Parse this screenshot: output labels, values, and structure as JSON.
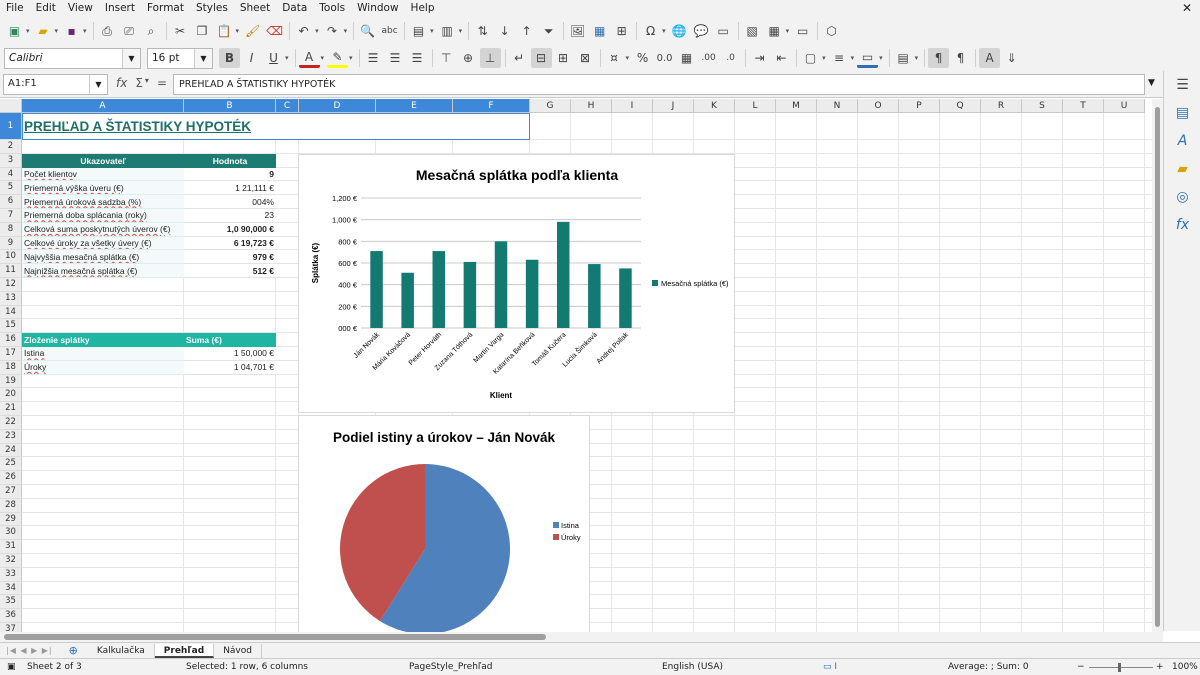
{
  "menu": [
    "File",
    "Edit",
    "View",
    "Insert",
    "Format",
    "Styles",
    "Sheet",
    "Data",
    "Tools",
    "Window",
    "Help"
  ],
  "toolbar": {
    "font_name": "Calibri",
    "font_size": "16 pt"
  },
  "formula": {
    "name_box": "A1:F1",
    "content": "PREHĽAD A ŠTATISTIKY HYPOTÉK"
  },
  "columns": [
    "A",
    "B",
    "C",
    "D",
    "E",
    "F",
    "G",
    "H",
    "I",
    "J",
    "K",
    "L",
    "M",
    "N",
    "O",
    "P",
    "Q",
    "R",
    "S",
    "T",
    "U"
  ],
  "rows": [
    "1",
    "2",
    "3",
    "4",
    "5",
    "6",
    "7",
    "8",
    "9",
    "10",
    "11",
    "12",
    "13",
    "14",
    "15",
    "16",
    "17",
    "18",
    "19",
    "20",
    "21",
    "22",
    "23",
    "24",
    "25",
    "26",
    "27",
    "28",
    "29",
    "30",
    "31",
    "32",
    "33",
    "34",
    "35",
    "36",
    "37"
  ],
  "sheet": {
    "title": "PREHĽAD A ŠTATISTIKY HYPOTÉK",
    "stats_header": {
      "label": "Ukazovateľ",
      "value": "Hodnota"
    },
    "stats": [
      {
        "label": "Počet klientov",
        "value": "9",
        "bold": true
      },
      {
        "label": "Priemerná výška úveru (€)",
        "value": "1 21,111 €",
        "bold": false
      },
      {
        "label": "Priemerná úroková sadzba (%)",
        "value": "004%",
        "bold": false
      },
      {
        "label": "Priemerná doba splácania (roky)",
        "value": "23",
        "bold": false
      },
      {
        "label": "Celková suma poskytnutých úverov (€)",
        "value": "1,0 90,000 €",
        "bold": true
      },
      {
        "label": "Celkové úroky za všetky úvery (€)",
        "value": "6 19,723 €",
        "bold": true
      },
      {
        "label": "Najvyššia mesačná splátka (€)",
        "value": "979 €",
        "bold": true
      },
      {
        "label": "Najnižšia mesačná splátka (€)",
        "value": "512 €",
        "bold": true
      }
    ],
    "comp_header": {
      "label": "Zloženie splátky",
      "value": "Suma (€)"
    },
    "comp": [
      {
        "label": "Istina",
        "value": "1 50,000 €"
      },
      {
        "label": "Úroky",
        "value": "1 04,701 €"
      }
    ]
  },
  "chart_data": [
    {
      "type": "bar",
      "title": "Mesačná splátka podľa klienta",
      "xlabel": "Klient",
      "ylabel": "Splátka (€)",
      "categories": [
        "Ján Novák",
        "Mária Kováčová",
        "Peter Horváth",
        "Zuzana Tóthová",
        "Martin Varga",
        "Katarína Beňková",
        "Tomáš Kučera",
        "Lucia Šimková",
        "Andrej Poliak"
      ],
      "series": [
        {
          "name": "Mesačná splátka (€)",
          "values": [
            710,
            510,
            710,
            610,
            800,
            630,
            980,
            590,
            550
          ]
        }
      ],
      "ylim": [
        0,
        1200
      ],
      "yticks": [
        "000 €",
        "200 €",
        "400 €",
        "600 €",
        "800 €",
        "1,000 €",
        "1,200 €"
      ],
      "color": "#137a72",
      "grid": true,
      "legend": "right"
    },
    {
      "type": "pie",
      "title": "Podiel istiny a úrokov – Ján Novák",
      "labels": [
        "Istina",
        "Úroky"
      ],
      "values": [
        150000,
        104701
      ],
      "colors": [
        "#4f81bd",
        "#c0504d"
      ],
      "legend": "right"
    }
  ],
  "tabs": [
    "Kalkulačka",
    "Prehľad",
    "Návod"
  ],
  "active_tab": "Prehľad",
  "status": {
    "sheet": "Sheet 2 of 3",
    "selection": "Selected: 1 row, 6 columns",
    "pagestyle": "PageStyle_Prehľad",
    "language": "English (USA)",
    "summary": "Average: ; Sum: 0",
    "zoom": "100%"
  }
}
